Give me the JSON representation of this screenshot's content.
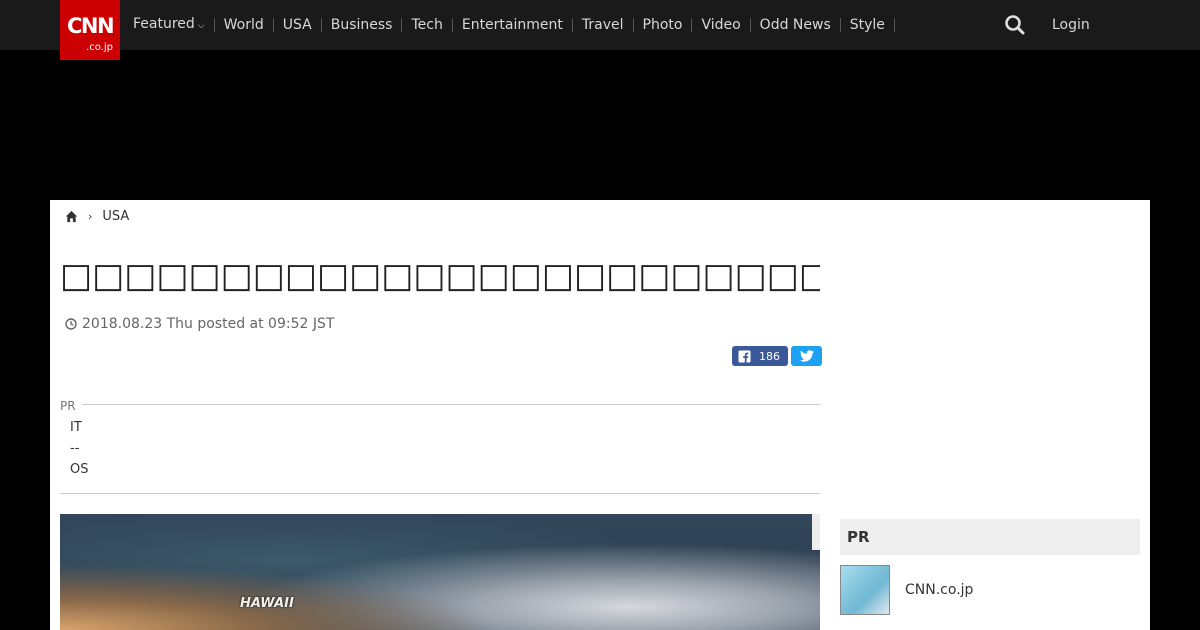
{
  "header": {
    "logo_text": "CNN",
    "logo_sub": ".co.jp",
    "nav": [
      {
        "label": "Featured",
        "has_dropdown": true
      },
      {
        "label": "World"
      },
      {
        "label": "USA"
      },
      {
        "label": "Business"
      },
      {
        "label": "Tech"
      },
      {
        "label": "Entertainment"
      },
      {
        "label": "Travel"
      },
      {
        "label": "Photo"
      },
      {
        "label": "Video"
      },
      {
        "label": "Odd News"
      },
      {
        "label": "Style"
      }
    ],
    "search_icon": "search-icon",
    "login_label": "Login"
  },
  "breadcrumb": {
    "home_icon": "home-icon",
    "current": "USA"
  },
  "article": {
    "title": "□□□□□□□□□□□□□□□□□□□□□□□□□□□□□□□",
    "date": "2018.08.23 Thu posted at 09:52 JST",
    "facebook_count": "186"
  },
  "pr_block": {
    "label": "PR",
    "items": [
      "IT",
      "--",
      "OS"
    ]
  },
  "hero": {
    "map_label": "HAWAII"
  },
  "sidebar": {
    "pr_label": "PR",
    "item_name": "CNN.co.jp"
  },
  "colors": {
    "brand": "#cc0000",
    "header_bg": "#1a1a1a",
    "facebook": "#3b5998",
    "twitter": "#1da1f2"
  }
}
